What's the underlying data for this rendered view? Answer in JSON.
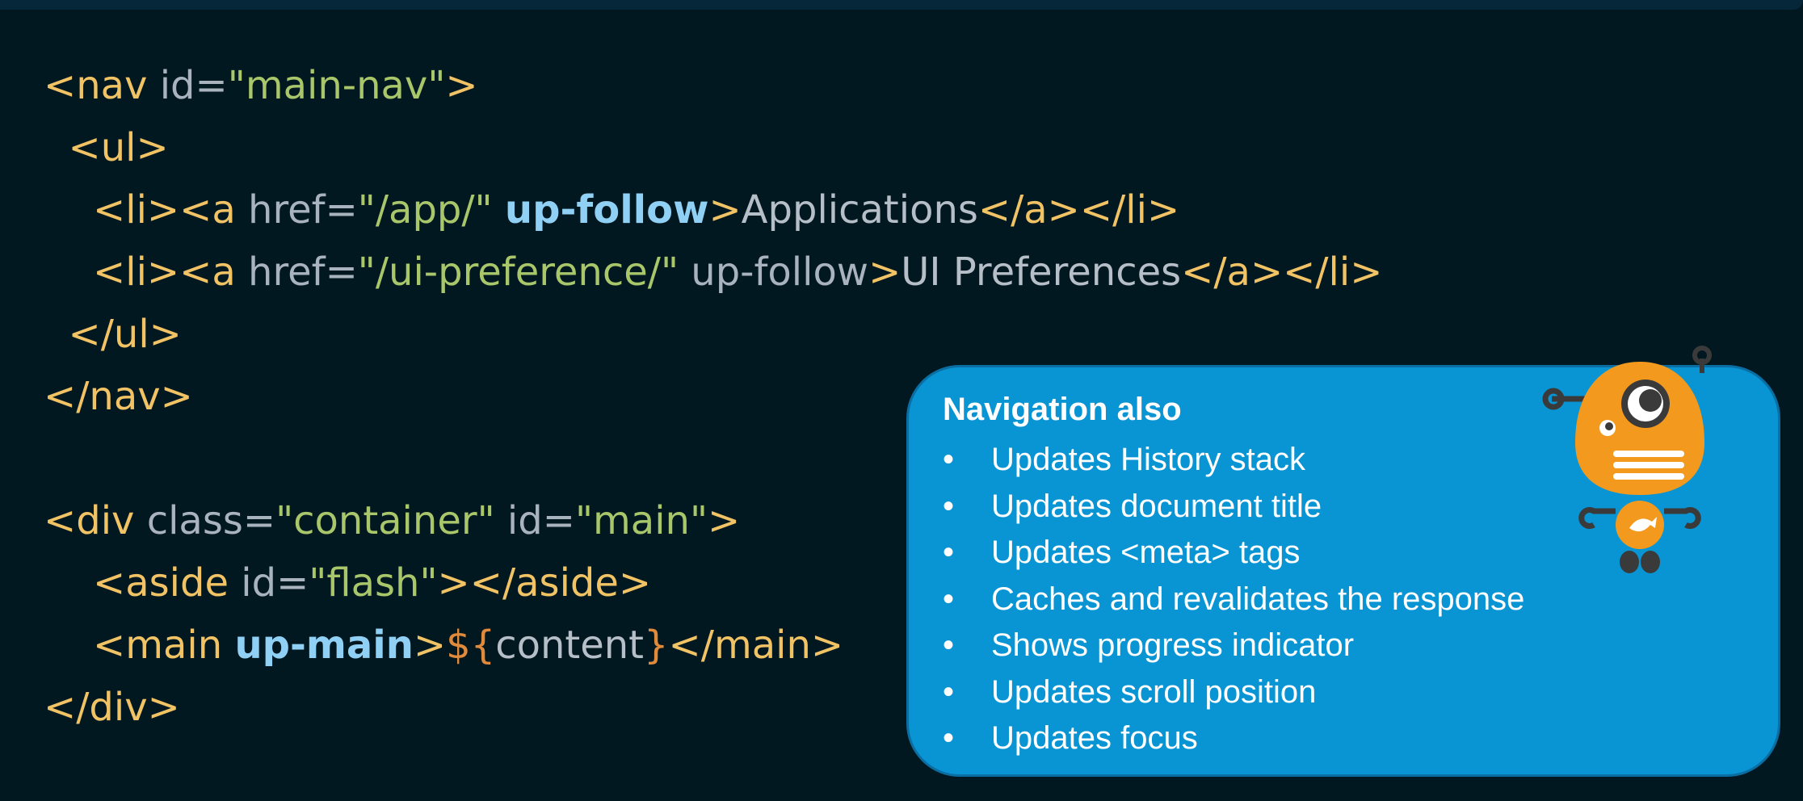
{
  "code_lines": [
    [
      {
        "t": "tag",
        "v": "<nav "
      },
      {
        "t": "attr",
        "v": "id="
      },
      {
        "t": "str",
        "v": "\"main-nav\""
      },
      {
        "t": "tag",
        "v": ">"
      }
    ],
    [
      {
        "t": "tag",
        "v": "  <ul>"
      }
    ],
    [
      {
        "t": "tag",
        "v": "    <li><a "
      },
      {
        "t": "attr",
        "v": "href="
      },
      {
        "t": "str",
        "v": "\"/app/\""
      },
      {
        "t": "attr",
        "v": " "
      },
      {
        "t": "kw",
        "v": "up-follow"
      },
      {
        "t": "tag",
        "v": ">"
      },
      {
        "t": "text",
        "v": "Applications"
      },
      {
        "t": "tag",
        "v": "</a></li>"
      }
    ],
    [
      {
        "t": "tag",
        "v": "    <li><a "
      },
      {
        "t": "attr",
        "v": "href="
      },
      {
        "t": "str",
        "v": "\"/ui-preference/\""
      },
      {
        "t": "attr",
        "v": " up-follow"
      },
      {
        "t": "tag",
        "v": ">"
      },
      {
        "t": "text",
        "v": "UI Preferences"
      },
      {
        "t": "tag",
        "v": "</a></li>"
      }
    ],
    [
      {
        "t": "tag",
        "v": "  </ul>"
      }
    ],
    [
      {
        "t": "tag",
        "v": "</nav>"
      }
    ],
    [],
    [
      {
        "t": "tag",
        "v": "<div "
      },
      {
        "t": "attr",
        "v": "class="
      },
      {
        "t": "str",
        "v": "\"container\""
      },
      {
        "t": "attr",
        "v": " id="
      },
      {
        "t": "str",
        "v": "\"main\""
      },
      {
        "t": "tag",
        "v": ">"
      }
    ],
    [
      {
        "t": "tag",
        "v": "    <aside "
      },
      {
        "t": "attr",
        "v": "id="
      },
      {
        "t": "str",
        "v": "\"flash\""
      },
      {
        "t": "tag",
        "v": "></aside>"
      }
    ],
    [
      {
        "t": "tag",
        "v": "    <main "
      },
      {
        "t": "kw",
        "v": "up-main"
      },
      {
        "t": "tag",
        "v": ">"
      },
      {
        "t": "interp",
        "v": "${"
      },
      {
        "t": "text",
        "v": "content"
      },
      {
        "t": "interp",
        "v": "}"
      },
      {
        "t": "tag",
        "v": "</main>"
      }
    ],
    [
      {
        "t": "tag",
        "v": "</div>"
      }
    ]
  ],
  "callout": {
    "title": "Navigation also",
    "bullet_glyph": "•",
    "items": [
      "Updates History stack",
      "Updates document title",
      "Updates <meta> tags",
      "Caches and revalidates the response",
      "Shows progress indicator",
      "Updates scroll position",
      "Updates focus"
    ]
  },
  "mascot": {
    "icon": "unpoly-robot-mascot-icon",
    "colors": {
      "body": "#f39a1e",
      "dark": "#3a3a3a",
      "eye": "#ffffff"
    }
  },
  "colors": {
    "background": "#011821",
    "tag": "#f2c365",
    "attribute": "#a9b3bd",
    "string": "#a9c76a",
    "keyword": "#8fd0f4",
    "text": "#b6bec7",
    "interpolation": "#e08a3c",
    "callout_bg": "#0994d3"
  }
}
